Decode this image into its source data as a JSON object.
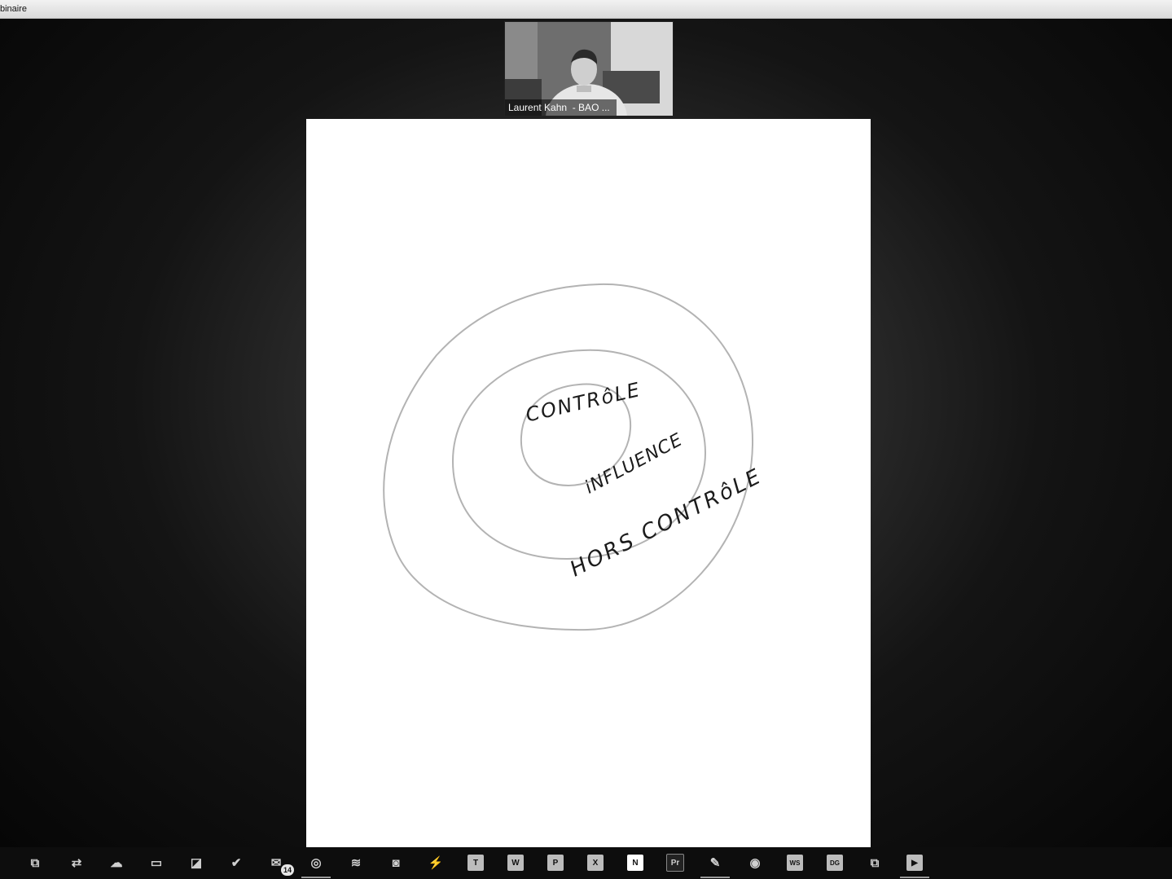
{
  "window": {
    "title": "binaire"
  },
  "video": {
    "participant_name": "Laurent Kahn  - BAO ..."
  },
  "whiteboard": {
    "labels": {
      "inner": "CONTRôLE",
      "middle": "iNFLUENCE",
      "outer": "HORS CONTRôLE"
    }
  },
  "taskbar": {
    "items": [
      {
        "name": "task-view-icon",
        "glyph": "⧉"
      },
      {
        "name": "teamviewer-icon",
        "glyph": "⇄"
      },
      {
        "name": "cloud-icon",
        "glyph": "☁"
      },
      {
        "name": "file-explorer-icon",
        "glyph": "▭"
      },
      {
        "name": "sticky-notes-icon",
        "glyph": "◪"
      },
      {
        "name": "todo-icon",
        "glyph": "✔"
      },
      {
        "name": "mail-icon",
        "glyph": "✉",
        "badge": "14"
      },
      {
        "name": "chrome-icon",
        "glyph": "◎"
      },
      {
        "name": "spotify-icon",
        "glyph": "≋"
      },
      {
        "name": "discord-icon",
        "glyph": "◙"
      },
      {
        "name": "messenger-icon",
        "glyph": "⚡"
      },
      {
        "name": "teams-icon",
        "glyph": "T"
      },
      {
        "name": "word-icon",
        "glyph": "W"
      },
      {
        "name": "powerpoint-icon",
        "glyph": "P"
      },
      {
        "name": "excel-icon",
        "glyph": "X"
      },
      {
        "name": "notion-icon",
        "glyph": "N"
      },
      {
        "name": "premiere-icon",
        "glyph": "Pr"
      },
      {
        "name": "drawing-app-icon",
        "glyph": "✎"
      },
      {
        "name": "github-icon",
        "glyph": "◉"
      },
      {
        "name": "webstorm-icon",
        "glyph": "WS"
      },
      {
        "name": "datagrip-icon",
        "glyph": "DG"
      },
      {
        "name": "window-switch-icon",
        "glyph": "⧉"
      },
      {
        "name": "zoom-icon",
        "glyph": "▶"
      }
    ]
  }
}
